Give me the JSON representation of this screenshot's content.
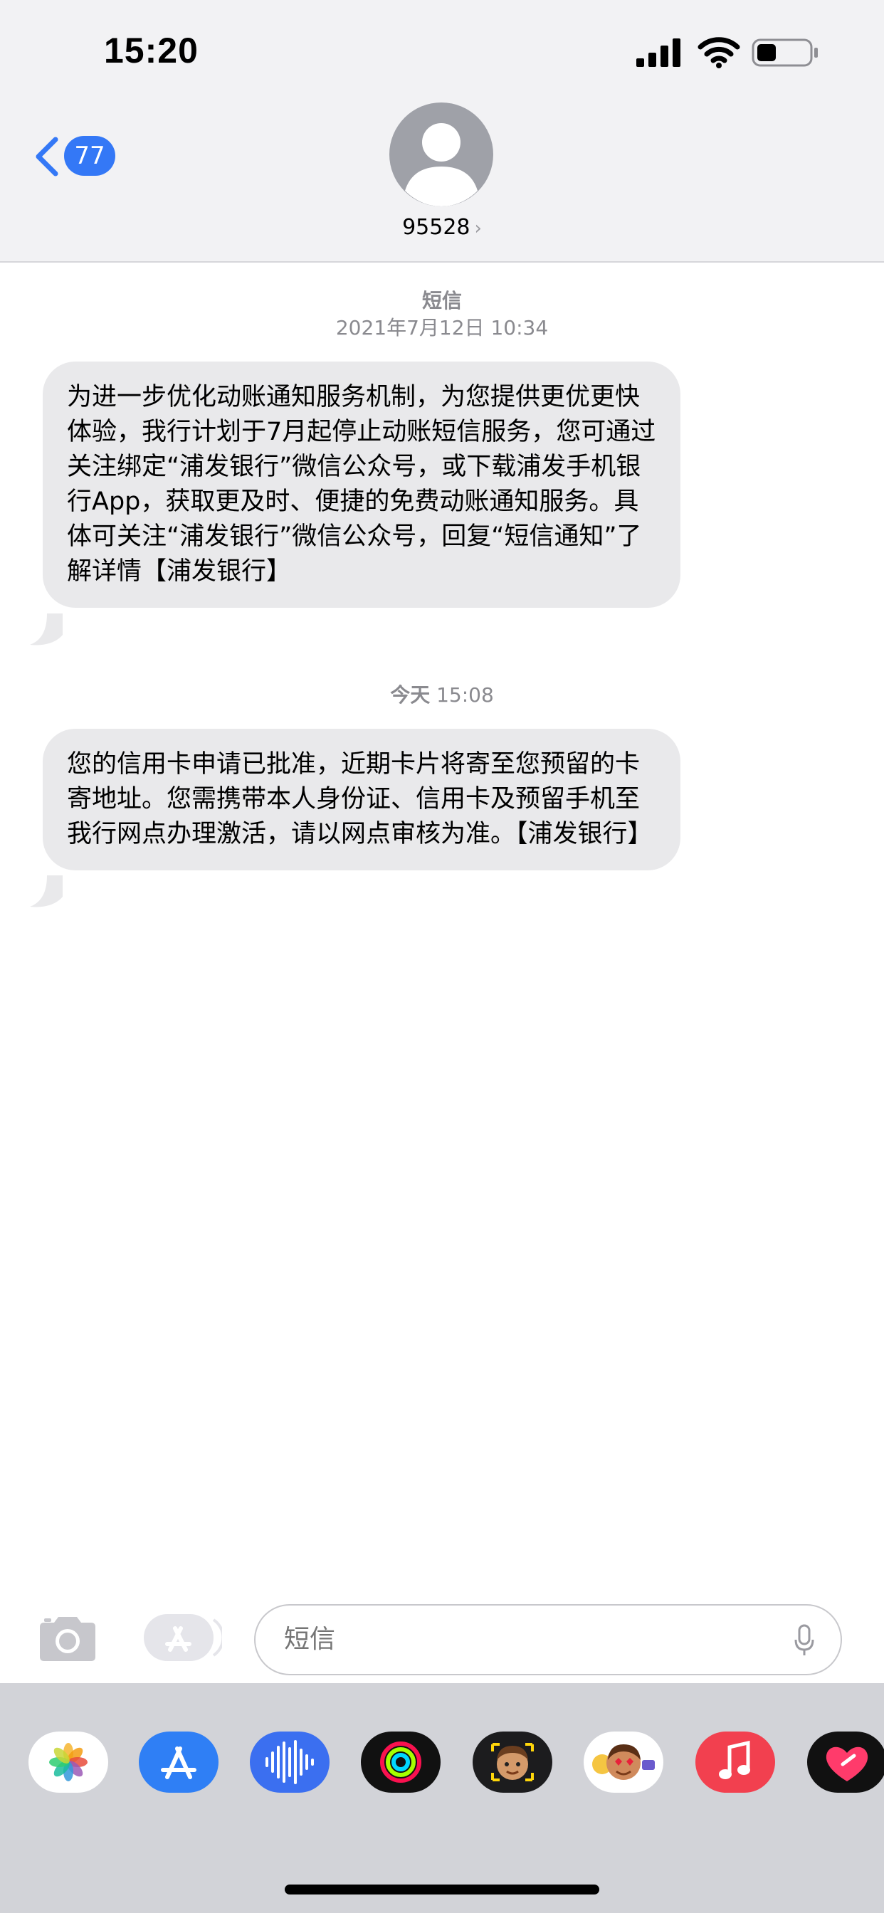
{
  "status_bar": {
    "time": "15:20"
  },
  "header": {
    "back_badge": "77",
    "contact": "95528",
    "contact_chevron": "›"
  },
  "messages": [
    {
      "stamp_title": "短信",
      "stamp_date": "2021年7月12日 10:34",
      "text": "为进一步优化动账通知服务机制，为您提供更优更快体验，我行计划于7月起停止动账短信服务，您可通过关注绑定“浦发银行”微信公众号，或下载浦发手机银行App，获取更及时、便捷的免费动账通知服务。具体可关注“浦发银行”微信公众号，回复“短信通知”了解详情【浦发银行】"
    },
    {
      "stamp_day": "今天",
      "stamp_time": "15:08",
      "text": "您的信用卡申请已批准，近期卡片将寄至您预留的卡寄地址。您需携带本人身份证、信用卡及预留手机至我行网点办理激活，请以网点审核为准。【浦发银行】"
    }
  ],
  "compose": {
    "placeholder": "短信"
  },
  "app_drawer": {
    "apps": [
      {
        "name": "photos-app-icon"
      },
      {
        "name": "app-store-icon"
      },
      {
        "name": "audio-message-icon"
      },
      {
        "name": "activity-app-icon"
      },
      {
        "name": "memoji-icon"
      },
      {
        "name": "memoji-stickers-icon"
      },
      {
        "name": "music-app-icon"
      },
      {
        "name": "heart-sticker-icon"
      }
    ]
  },
  "colors": {
    "accent": "#3478f6",
    "bubble": "#e9e9eb",
    "header_bg": "#f2f2f4",
    "drawer_bg": "#d2d3d8"
  }
}
